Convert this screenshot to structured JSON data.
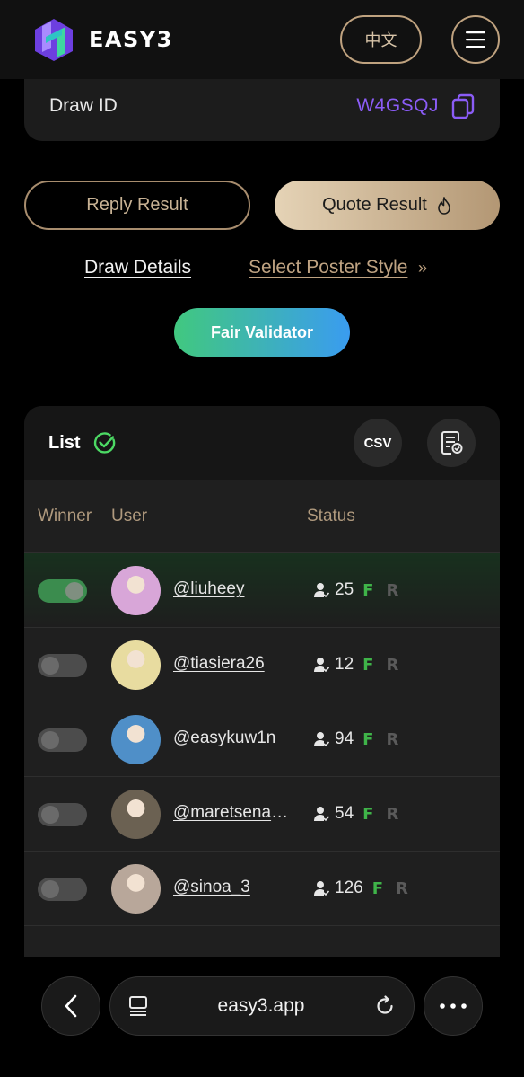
{
  "header": {
    "brand": "EASY3",
    "lang_label": "中文"
  },
  "draw": {
    "label": "Draw ID",
    "id": "W4GSQJ"
  },
  "actions": {
    "reply_label": "Reply Result",
    "quote_label": "Quote Result"
  },
  "links": {
    "details": "Draw Details",
    "poster": "Select Poster Style",
    "poster_chevron": "»"
  },
  "fair_validator": "Fair Validator",
  "list": {
    "title": "List",
    "csv_label": "CSV",
    "columns": [
      "Winner",
      "User",
      "Status"
    ],
    "rows": [
      {
        "winner": true,
        "handle": "@liuheey",
        "count": "25",
        "f": "F",
        "r": "R",
        "avatar_color": "#d8a6d8"
      },
      {
        "winner": false,
        "handle": "@tiasiera26",
        "count": "12",
        "f": "F",
        "r": "R",
        "avatar_color": "#e8dca0"
      },
      {
        "winner": false,
        "handle": "@easykuw1n",
        "count": "94",
        "f": "F",
        "r": "R",
        "avatar_color": "#4f8fc8"
      },
      {
        "winner": false,
        "handle": "@maretsenayo…",
        "count": "54",
        "f": "F",
        "r": "R",
        "avatar_color": "#6b6152"
      },
      {
        "winner": false,
        "handle": "@sinoa_3",
        "count": "126",
        "f": "F",
        "r": "R",
        "avatar_color": "#b8a79a"
      }
    ]
  },
  "browser": {
    "url": "easy3.app"
  },
  "colors": {
    "accent_gold": "#bfa27f",
    "accent_purple": "#8b5cf6",
    "accent_green": "#3fb449"
  }
}
